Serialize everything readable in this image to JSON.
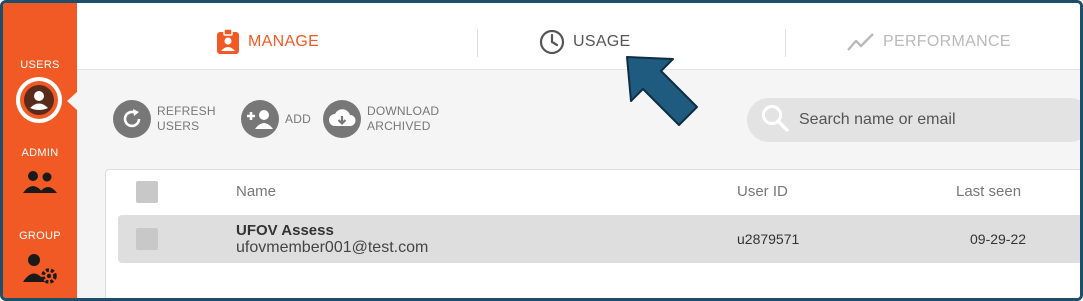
{
  "sidebar": {
    "items": [
      {
        "label": "USERS",
        "icon": "user-circle-icon",
        "active": true
      },
      {
        "label": "ADMIN",
        "icon": "people-icon",
        "active": false
      },
      {
        "label": "GROUP",
        "icon": "user-gear-icon",
        "active": false
      }
    ],
    "color": "#f15a24"
  },
  "tabs": [
    {
      "label": "MANAGE",
      "icon": "badge-icon",
      "active": true,
      "color": "#f15a24"
    },
    {
      "label": "USAGE",
      "icon": "clock-icon",
      "active": false,
      "color": "#555555"
    },
    {
      "label": "PERFORMANCE",
      "icon": "trend-line-icon",
      "active": false,
      "color": "#b9b9b9"
    }
  ],
  "actions": {
    "refresh": {
      "label_line1": "REFRESH",
      "label_line2": "USERS",
      "icon": "refresh-icon"
    },
    "add": {
      "label": "ADD",
      "icon": "add-user-icon"
    },
    "download": {
      "label_line1": "DOWNLOAD",
      "label_line2": "ARCHIVED",
      "icon": "cloud-download-icon"
    }
  },
  "search": {
    "placeholder": "Search name or email",
    "value": ""
  },
  "table": {
    "columns": [
      "Name",
      "User ID",
      "Last seen"
    ],
    "rows": [
      {
        "name": "UFOV Assess",
        "email": "ufovmember001@test.com",
        "user_id": "u2879571",
        "last_seen": "09-29-22"
      }
    ]
  },
  "annotation": {
    "type": "arrow",
    "color": "#1f5a7f",
    "points_to": "USAGE"
  }
}
